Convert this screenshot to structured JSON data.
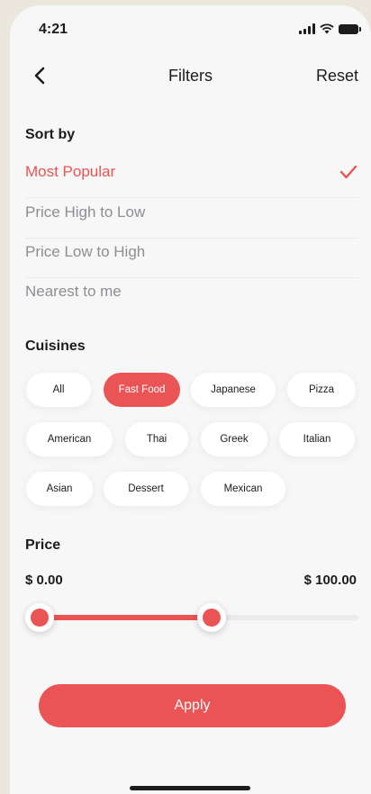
{
  "status_bar": {
    "time": "4:21"
  },
  "nav": {
    "title": "Filters",
    "reset_label": "Reset",
    "back_icon": "chevron-left-icon"
  },
  "sort": {
    "title": "Sort by",
    "items": [
      {
        "label": "Most Popular",
        "selected": true
      },
      {
        "label": "Price High to Low",
        "selected": false
      },
      {
        "label": "Price Low to High",
        "selected": false
      },
      {
        "label": "Nearest to me",
        "selected": false
      }
    ]
  },
  "cuisines": {
    "title": "Cuisines",
    "chips": [
      {
        "label": "All",
        "selected": false
      },
      {
        "label": "Fast Food",
        "selected": true
      },
      {
        "label": "Japanese",
        "selected": false
      },
      {
        "label": "Pizza",
        "selected": false
      },
      {
        "label": "American",
        "selected": false
      },
      {
        "label": "Thai",
        "selected": false
      },
      {
        "label": "Greek",
        "selected": false
      },
      {
        "label": "Italian",
        "selected": false
      },
      {
        "label": "Asian",
        "selected": false
      },
      {
        "label": "Dessert",
        "selected": false
      },
      {
        "label": "Mexican",
        "selected": false
      }
    ]
  },
  "price": {
    "title": "Price",
    "min_label": "$ 0.00",
    "max_label": "$ 100.00",
    "range_min": 0,
    "range_max": 100,
    "selected_low": 0,
    "selected_high": 54
  },
  "apply_label": "Apply",
  "colors": {
    "accent": "#ea5455",
    "muted_text": "#8e8e93",
    "background": "#f7f7f7"
  }
}
